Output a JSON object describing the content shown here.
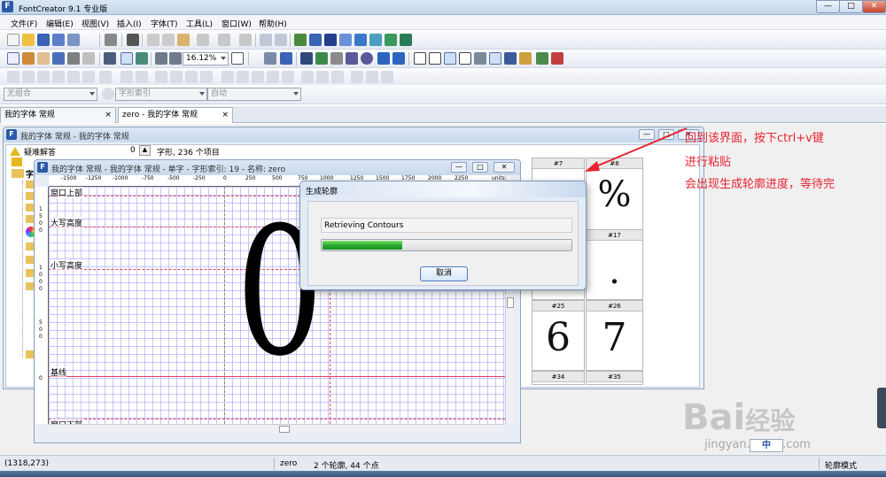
{
  "app": {
    "title": "FontCreator 9.1 专业版",
    "icon_letter": "F"
  },
  "window_controls": {
    "minimize": "—",
    "maximize": "□",
    "close": "✕"
  },
  "menu": [
    "文件(F)",
    "编辑(E)",
    "视图(V)",
    "插入(I)",
    "字体(T)",
    "工具(L)",
    "窗口(W)",
    "帮助(H)"
  ],
  "toolbar": {
    "zoom": "16.12%",
    "combo_group": "无组合",
    "combo_index": "字形索引",
    "combo_auto": "自动"
  },
  "tabs": [
    {
      "label": "我的字体 常规",
      "close": "×"
    },
    {
      "label": "zero - 我的字体 常规",
      "close": "×"
    }
  ],
  "font_window": {
    "title": "我的字体 常规 - 我的字体 常规",
    "troubleshoot": "疑难解答",
    "troubleshoot_count": "0",
    "summary": "字形, 236 个项目",
    "folder_partial": "字"
  },
  "glyph_cells": [
    {
      "id": "#7",
      "char": ""
    },
    {
      "id": "#8",
      "char": "%"
    },
    {
      "id": "#17",
      "char": "."
    },
    {
      "id": "#25",
      "char": "6"
    },
    {
      "id": "#26",
      "char": "7"
    },
    {
      "id": "#34",
      "char": ""
    },
    {
      "id": "#35",
      "char": ""
    }
  ],
  "glyph_window": {
    "title": "我的字体 常规 - 我的字体 常规 - 单字 - 字形索引: 19 - 名称: zero",
    "ruler": [
      "-1500",
      "-1250",
      "-1000",
      "-750",
      "-500",
      "-250",
      "0",
      "250",
      "500",
      "750",
      "1000",
      "1250",
      "1500",
      "1750",
      "2000",
      "2250",
      "units"
    ],
    "left_ruler": [
      "1",
      "5",
      "0",
      "0",
      "1",
      "0",
      "0",
      "0",
      "5",
      "0",
      "0",
      "0"
    ],
    "glyph": "0",
    "metric_lines": [
      "窗口上部",
      "大写高度",
      "小写高度",
      "基线",
      "窗口下部"
    ],
    "baseline_zero": "0"
  },
  "dialog": {
    "title": "生成轮廓",
    "status": "Retrieving Contours",
    "progress": 0.32,
    "cancel": "取消"
  },
  "status": {
    "coords": "(1318,273)",
    "glyph": "zero",
    "info": "2 个轮廓, 44 个点",
    "mode": "轮廓模式"
  },
  "annotation": {
    "lines": [
      "回到该界面，按下ctrl+v键",
      "进行粘贴",
      "会出现生成轮廓进度，等待完"
    ],
    "color": "#e8232f"
  },
  "watermark": {
    "brand": "Bai",
    "brand_cn": "经验",
    "url": "jingyan.baidu.com",
    "badge": "中"
  }
}
